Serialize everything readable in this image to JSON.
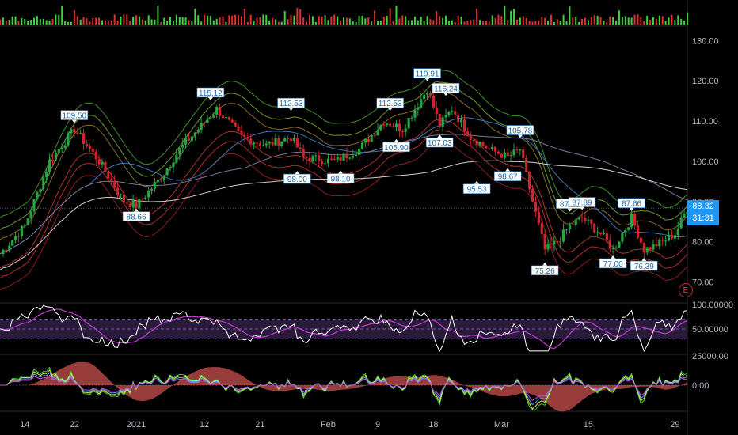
{
  "chart_data": {
    "type": "candlestick-with-indicators",
    "price_axis": {
      "ticks": [
        "130.00",
        "120.00",
        "110.00",
        "100.00",
        "90.00",
        "80.00",
        "70.00"
      ],
      "tick_values": [
        130,
        120,
        110,
        100,
        90,
        80,
        70
      ],
      "range": [
        65,
        133
      ]
    },
    "time_axis": {
      "ticks": [
        "14",
        "22",
        "2021",
        "12",
        "21",
        "Feb",
        "9",
        "18",
        "Mar",
        "15",
        "29"
      ],
      "range": [
        "2020-12-10",
        "2021-03-31"
      ]
    },
    "last_price": {
      "value": "88.32",
      "countdown": "31:31"
    },
    "earnings_marker": "E",
    "rsi_panel": {
      "ticks": [
        "100.00000",
        "50.00000"
      ],
      "levels": [
        70,
        50,
        30
      ]
    },
    "oscillator_panel": {
      "ticks": [
        "25000.00",
        "0.00"
      ]
    },
    "price_labels": [
      {
        "text": "109.50",
        "position": "above",
        "date": "2020-12-22",
        "price": 109.5
      },
      {
        "text": "88.66",
        "position": "below",
        "date": "2021-01-01",
        "price": 88.66
      },
      {
        "text": "115.12",
        "position": "above",
        "date": "2021-01-13",
        "price": 115.12
      },
      {
        "text": "112.53",
        "position": "above",
        "date": "2021-01-26",
        "price": 112.53
      },
      {
        "text": "98.00",
        "position": "below",
        "date": "2021-01-27",
        "price": 98.0
      },
      {
        "text": "98.10",
        "position": "below",
        "date": "2021-02-03",
        "price": 98.1
      },
      {
        "text": "112.53",
        "position": "above",
        "date": "2021-02-11",
        "price": 112.53
      },
      {
        "text": "105.90",
        "position": "below",
        "date": "2021-02-12",
        "price": 105.9
      },
      {
        "text": "119.91",
        "position": "above",
        "date": "2021-02-17",
        "price": 119.91
      },
      {
        "text": "107.03",
        "position": "below",
        "date": "2021-02-19",
        "price": 107.03
      },
      {
        "text": "116.24",
        "position": "above",
        "date": "2021-02-20",
        "price": 116.24
      },
      {
        "text": "95.53",
        "position": "below",
        "date": "2021-02-25",
        "price": 95.53
      },
      {
        "text": "98.67",
        "position": "below",
        "date": "2021-03-02",
        "price": 98.67
      },
      {
        "text": "105.78",
        "position": "above",
        "date": "2021-03-04",
        "price": 105.78
      },
      {
        "text": "75.26",
        "position": "below",
        "date": "2021-03-08",
        "price": 75.26
      },
      {
        "text": "87.47",
        "position": "above",
        "date": "2021-03-12",
        "price": 87.47
      },
      {
        "text": "87.89",
        "position": "above",
        "date": "2021-03-14",
        "price": 87.89
      },
      {
        "text": "77.00",
        "position": "below",
        "date": "2021-03-19",
        "price": 77.0
      },
      {
        "text": "87.66",
        "position": "above",
        "date": "2021-03-22",
        "price": 87.66
      },
      {
        "text": "76.39",
        "position": "below",
        "date": "2021-03-24",
        "price": 76.39
      }
    ],
    "series_close_approx": [
      {
        "date": "2020-12-10",
        "close": 77
      },
      {
        "date": "2020-12-14",
        "close": 84
      },
      {
        "date": "2020-12-18",
        "close": 100
      },
      {
        "date": "2020-12-22",
        "close": 108
      },
      {
        "date": "2020-12-26",
        "close": 100
      },
      {
        "date": "2020-12-30",
        "close": 90
      },
      {
        "date": "2021-01-01",
        "close": 89
      },
      {
        "date": "2021-01-05",
        "close": 96
      },
      {
        "date": "2021-01-08",
        "close": 103
      },
      {
        "date": "2021-01-11",
        "close": 108
      },
      {
        "date": "2021-01-14",
        "close": 113
      },
      {
        "date": "2021-01-18",
        "close": 106
      },
      {
        "date": "2021-01-22",
        "close": 104
      },
      {
        "date": "2021-01-26",
        "close": 106
      },
      {
        "date": "2021-01-28",
        "close": 101
      },
      {
        "date": "2021-02-02",
        "close": 100
      },
      {
        "date": "2021-02-06",
        "close": 103
      },
      {
        "date": "2021-02-10",
        "close": 110
      },
      {
        "date": "2021-02-13",
        "close": 108
      },
      {
        "date": "2021-02-17",
        "close": 118
      },
      {
        "date": "2021-02-19",
        "close": 109
      },
      {
        "date": "2021-02-21",
        "close": 113
      },
      {
        "date": "2021-02-24",
        "close": 106
      },
      {
        "date": "2021-02-27",
        "close": 103
      },
      {
        "date": "2021-03-02",
        "close": 101
      },
      {
        "date": "2021-03-04",
        "close": 103
      },
      {
        "date": "2021-03-06",
        "close": 90
      },
      {
        "date": "2021-03-08",
        "close": 78
      },
      {
        "date": "2021-03-10",
        "close": 80
      },
      {
        "date": "2021-03-12",
        "close": 84
      },
      {
        "date": "2021-03-14",
        "close": 86
      },
      {
        "date": "2021-03-17",
        "close": 82
      },
      {
        "date": "2021-03-19",
        "close": 78
      },
      {
        "date": "2021-03-22",
        "close": 86
      },
      {
        "date": "2021-03-24",
        "close": 78
      },
      {
        "date": "2021-03-27",
        "close": 80
      },
      {
        "date": "2021-03-29",
        "close": 82
      },
      {
        "date": "2021-03-31",
        "close": 88.32
      }
    ],
    "colors": {
      "up": "#26a641",
      "down": "#d0242f",
      "rsi": "#ffffff",
      "rsi_ma": "#c13ed3",
      "rsi_band": "#2a1a3a",
      "osc_fill": "#c9504f",
      "grid": "#1e1e1e",
      "badge": "#2196f3"
    }
  }
}
